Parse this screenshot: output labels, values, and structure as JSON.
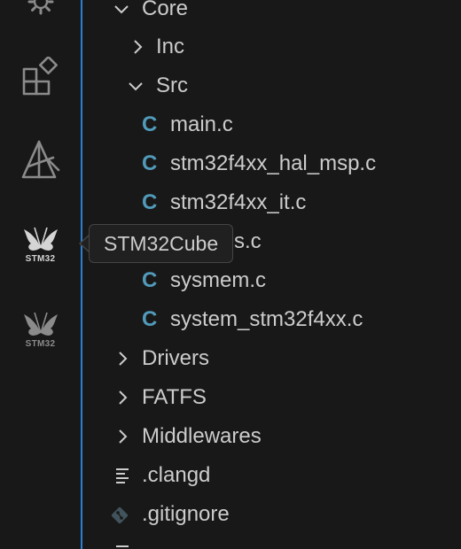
{
  "colors": {
    "background": "#181818",
    "text": "#cccccc",
    "c_file_icon": "#519aba",
    "activity_icon": "#8b8b8b",
    "activity_icon_active": "#cfcfcf",
    "focus_border": "#2b7fd3",
    "tooltip_bg": "#202020"
  },
  "activity_bar": {
    "items": [
      {
        "icon": "gear-icon"
      },
      {
        "icon": "extensions-icon"
      },
      {
        "icon": "build-tools-icon"
      },
      {
        "icon": "stm32-butterfly-icon",
        "label": "STM32",
        "active": true
      },
      {
        "icon": "stm32-butterfly-icon",
        "label": "STM32",
        "active": false
      }
    ]
  },
  "tooltip": {
    "text": "STM32Cube"
  },
  "explorer": {
    "rows": [
      {
        "label": "Core",
        "type": "folder",
        "expanded": true
      },
      {
        "label": "Inc",
        "type": "folder",
        "expanded": false
      },
      {
        "label": "Src",
        "type": "folder",
        "expanded": true
      },
      {
        "label": "main.c",
        "type": "c-file",
        "icon_text": "C"
      },
      {
        "label": "stm32f4xx_hal_msp.c",
        "type": "c-file",
        "icon_text": "C"
      },
      {
        "label": "stm32f4xx_it.c",
        "type": "c-file",
        "icon_text": "C"
      },
      {
        "label": "syscalls.c",
        "type": "c-file",
        "icon_text": "C"
      },
      {
        "label": "sysmem.c",
        "type": "c-file",
        "icon_text": "C"
      },
      {
        "label": "system_stm32f4xx.c",
        "type": "c-file",
        "icon_text": "C"
      },
      {
        "label": "Drivers",
        "type": "folder",
        "expanded": false
      },
      {
        "label": "FATFS",
        "type": "folder",
        "expanded": false
      },
      {
        "label": "Middlewares",
        "type": "folder",
        "expanded": false
      },
      {
        "label": ".clangd",
        "type": "text-file"
      },
      {
        "label": ".gitignore",
        "type": "git-file"
      }
    ]
  }
}
